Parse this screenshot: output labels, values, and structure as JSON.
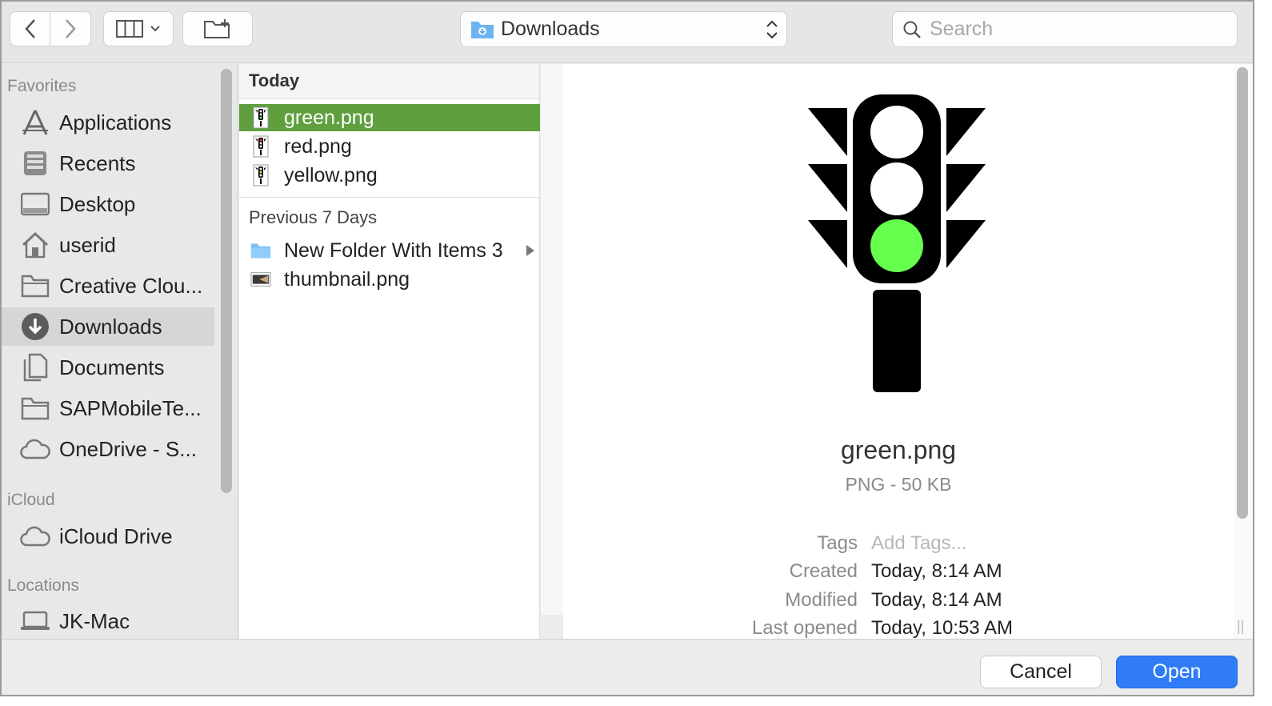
{
  "toolbar": {
    "path": {
      "label": "Downloads"
    },
    "search": {
      "placeholder": "Search"
    }
  },
  "sidebar": {
    "sections": [
      {
        "label": "Favorites"
      },
      {
        "label": "iCloud"
      },
      {
        "label": "Locations"
      }
    ],
    "favorites": [
      {
        "label": "Applications",
        "icon": "applications-icon"
      },
      {
        "label": "Recents",
        "icon": "recents-icon"
      },
      {
        "label": "Desktop",
        "icon": "desktop-icon"
      },
      {
        "label": "userid",
        "icon": "home-icon"
      },
      {
        "label": "Creative Clou...",
        "icon": "folder-icon"
      },
      {
        "label": "Downloads",
        "icon": "downloads-icon",
        "selected": true
      },
      {
        "label": "Documents",
        "icon": "documents-icon"
      },
      {
        "label": "SAPMobileTe...",
        "icon": "folder-icon"
      },
      {
        "label": "OneDrive - S...",
        "icon": "cloud-icon"
      }
    ],
    "icloud": [
      {
        "label": "iCloud Drive",
        "icon": "cloud-icon"
      }
    ],
    "locations": [
      {
        "label": "JK-Mac",
        "icon": "laptop-icon"
      }
    ]
  },
  "column": {
    "header": "Today",
    "today": [
      {
        "name": "green.png",
        "icon": "traffic-light-icon",
        "selected": true
      },
      {
        "name": "red.png",
        "icon": "traffic-light-icon"
      },
      {
        "name": "yellow.png",
        "icon": "traffic-light-icon"
      }
    ],
    "previous_label": "Previous 7 Days",
    "previous": [
      {
        "name": "New Folder With Items 3",
        "icon": "folder-icon",
        "has_children": true
      },
      {
        "name": "thumbnail.png",
        "icon": "image-thumbnail-icon"
      }
    ]
  },
  "preview": {
    "name": "green.png",
    "kind": "PNG - 50 KB",
    "active_light": "#66ff4d",
    "meta": [
      {
        "key": "Tags",
        "value": "Add Tags...",
        "placeholder": true
      },
      {
        "key": "Created",
        "value": "Today, 8:14 AM"
      },
      {
        "key": "Modified",
        "value": "Today, 8:14 AM"
      },
      {
        "key": "Last opened",
        "value": "Today, 10:53 AM"
      }
    ]
  },
  "footer": {
    "cancel_label": "Cancel",
    "open_label": "Open"
  },
  "colors": {
    "selection": "#5f9f3e",
    "primary_button": "#2f7cf6"
  }
}
